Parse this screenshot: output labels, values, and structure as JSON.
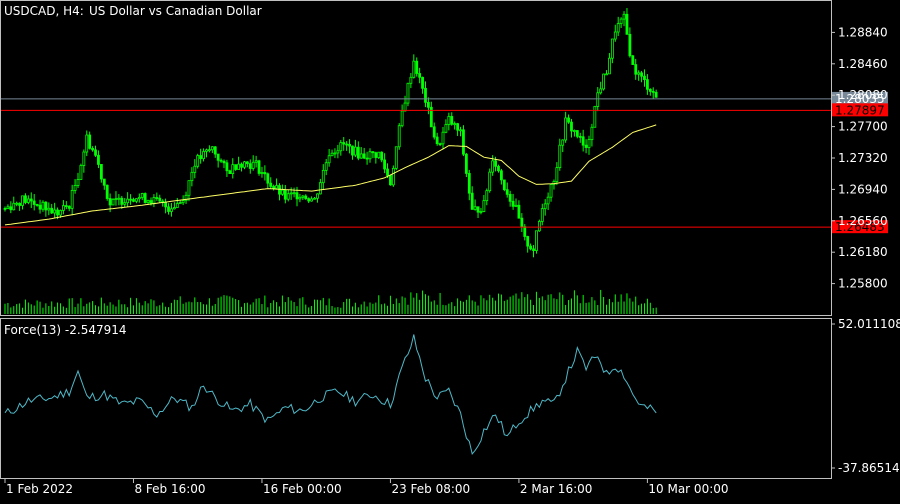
{
  "header": {
    "symbol_label": "USDCAD, H4:",
    "description": "US Dollar vs Canadian Dollar"
  },
  "indicator": {
    "label": "Force(13) -2.547914"
  },
  "colors": {
    "background": "#000000",
    "axis_text": "#ffffff",
    "frame": "#c0c0c0",
    "candle": "#00ff00",
    "volume": "#00ff00",
    "moving_average": "#ffff66",
    "force_line": "#4fb8c8",
    "support_resistance": "#ff0000",
    "bid_line": "#778899",
    "bid_tag_bg": "#778899",
    "level_tag_bg": "#ff0000"
  },
  "chart_data": [
    {
      "type": "candlestick",
      "title": "USDCAD, H4:  US Dollar vs Canadian Dollar",
      "ylim": [
        1.2542,
        1.2922
      ],
      "y_ticks": [
        "1.28840",
        "1.28460",
        "1.28080",
        "1.27700",
        "1.27320",
        "1.26940",
        "1.26560",
        "1.26180",
        "1.25800"
      ],
      "y_tick_values": [
        1.2884,
        1.2846,
        1.2808,
        1.277,
        1.2732,
        1.2694,
        1.2656,
        1.2618,
        1.258
      ],
      "x_ticks": [
        "1 Feb 2022",
        "8 Feb 16:00",
        "16 Feb 00:00",
        "23 Feb 08:00",
        "2 Mar 16:00",
        "10 Mar 00:00"
      ],
      "x_tick_bar_index": [
        0,
        44,
        88,
        132,
        176,
        220
      ],
      "bar_count": 224,
      "price_series_keypoints": [
        [
          0,
          1.2671
        ],
        [
          6,
          1.2682
        ],
        [
          11,
          1.2676
        ],
        [
          18,
          1.2665
        ],
        [
          22,
          1.2676
        ],
        [
          25,
          1.2711
        ],
        [
          28,
          1.2756
        ],
        [
          31,
          1.2735
        ],
        [
          36,
          1.2676
        ],
        [
          43,
          1.2686
        ],
        [
          50,
          1.2682
        ],
        [
          56,
          1.2672
        ],
        [
          61,
          1.2681
        ],
        [
          65,
          1.2727
        ],
        [
          71,
          1.2744
        ],
        [
          76,
          1.2715
        ],
        [
          80,
          1.2727
        ],
        [
          86,
          1.2724
        ],
        [
          91,
          1.27
        ],
        [
          96,
          1.2684
        ],
        [
          101,
          1.2689
        ],
        [
          106,
          1.2681
        ],
        [
          111,
          1.2739
        ],
        [
          116,
          1.2748
        ],
        [
          122,
          1.2735
        ],
        [
          128,
          1.2737
        ],
        [
          132,
          1.2702
        ],
        [
          136,
          1.2787
        ],
        [
          140,
          1.285
        ],
        [
          144,
          1.2802
        ],
        [
          148,
          1.2745
        ],
        [
          152,
          1.2778
        ],
        [
          156,
          1.2761
        ],
        [
          160,
          1.2667
        ],
        [
          164,
          1.2675
        ],
        [
          167,
          1.2734
        ],
        [
          171,
          1.2698
        ],
        [
          175,
          1.2669
        ],
        [
          178,
          1.2632
        ],
        [
          181,
          1.2622
        ],
        [
          184,
          1.2671
        ],
        [
          188,
          1.2708
        ],
        [
          192,
          1.2776
        ],
        [
          196,
          1.276
        ],
        [
          199,
          1.274
        ],
        [
          203,
          1.281
        ],
        [
          206,
          1.2838
        ],
        [
          209,
          1.2888
        ],
        [
          212,
          1.29
        ],
        [
          215,
          1.2842
        ],
        [
          218,
          1.2828
        ],
        [
          221,
          1.2816
        ],
        [
          223,
          1.2806
        ]
      ],
      "moving_average_keypoints": [
        [
          0,
          1.2651
        ],
        [
          15,
          1.2658
        ],
        [
          30,
          1.2668
        ],
        [
          45,
          1.2674
        ],
        [
          60,
          1.2681
        ],
        [
          75,
          1.2688
        ],
        [
          90,
          1.2695
        ],
        [
          105,
          1.2692
        ],
        [
          120,
          1.2699
        ],
        [
          130,
          1.2708
        ],
        [
          138,
          1.2722
        ],
        [
          145,
          1.2733
        ],
        [
          152,
          1.2747
        ],
        [
          158,
          1.2746
        ],
        [
          164,
          1.2733
        ],
        [
          170,
          1.2729
        ],
        [
          176,
          1.271
        ],
        [
          182,
          1.27
        ],
        [
          188,
          1.2701
        ],
        [
          194,
          1.2704
        ],
        [
          200,
          1.2728
        ],
        [
          208,
          1.2745
        ],
        [
          215,
          1.2763
        ],
        [
          223,
          1.2772
        ]
      ],
      "horizontal_levels": [
        {
          "price": 1.28035,
          "label": "1.28035",
          "kind": "bid"
        },
        {
          "price": 1.27897,
          "label": "1.27897",
          "kind": "resistance"
        },
        {
          "price": 1.26483,
          "label": "1.26483",
          "kind": "support"
        }
      ],
      "volume_keypoints": [
        [
          0,
          0.55
        ],
        [
          40,
          0.6
        ],
        [
          80,
          0.7
        ],
        [
          120,
          0.6
        ],
        [
          136,
          0.95
        ],
        [
          160,
          0.7
        ],
        [
          180,
          0.8
        ],
        [
          209,
          0.9
        ],
        [
          223,
          0.5
        ]
      ]
    },
    {
      "type": "line",
      "title": "Force(13) -2.547914",
      "ylim": [
        -37.86514,
        52.011108
      ],
      "y_ticks": [
        "52.011108",
        "-37.865140"
      ],
      "y_tick_values": [
        52.011108,
        -37.86514
      ],
      "series": [
        {
          "name": "Force(13)",
          "keypoints": [
            [
              0,
              -4
            ],
            [
              8,
              4
            ],
            [
              16,
              6
            ],
            [
              22,
              10
            ],
            [
              25,
              22
            ],
            [
              28,
              6
            ],
            [
              34,
              8
            ],
            [
              40,
              2
            ],
            [
              46,
              4
            ],
            [
              52,
              -4
            ],
            [
              58,
              6
            ],
            [
              64,
              0
            ],
            [
              68,
              14
            ],
            [
              72,
              6
            ],
            [
              78,
              -2
            ],
            [
              84,
              2
            ],
            [
              90,
              -8
            ],
            [
              96,
              0
            ],
            [
              102,
              -2
            ],
            [
              108,
              6
            ],
            [
              114,
              10
            ],
            [
              120,
              4
            ],
            [
              126,
              8
            ],
            [
              132,
              2
            ],
            [
              136,
              24
            ],
            [
              140,
              42
            ],
            [
              144,
              18
            ],
            [
              148,
              6
            ],
            [
              152,
              10
            ],
            [
              156,
              -4
            ],
            [
              160,
              -28
            ],
            [
              164,
              -14
            ],
            [
              168,
              -4
            ],
            [
              172,
              -18
            ],
            [
              176,
              -8
            ],
            [
              180,
              -2
            ],
            [
              184,
              4
            ],
            [
              188,
              2
            ],
            [
              192,
              18
            ],
            [
              196,
              34
            ],
            [
              199,
              24
            ],
            [
              203,
              32
            ],
            [
              206,
              20
            ],
            [
              209,
              26
            ],
            [
              212,
              20
            ],
            [
              215,
              8
            ],
            [
              218,
              1
            ],
            [
              221,
              -1
            ],
            [
              223,
              -2.547914
            ]
          ]
        }
      ]
    }
  ]
}
